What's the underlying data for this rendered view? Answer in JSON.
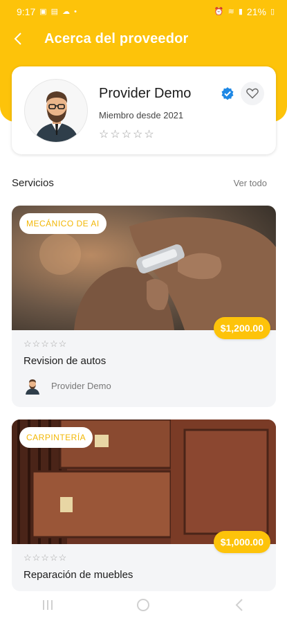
{
  "status_bar": {
    "time": "9:17",
    "battery": "21%"
  },
  "app_bar": {
    "title": "Acerca del proveedor",
    "back_icon": "back-arrow-icon"
  },
  "provider": {
    "name": "Provider Demo",
    "member_since": "Miembro desde 2021",
    "rating_stars": "☆☆☆☆☆",
    "verified_icon": "verified-badge-icon",
    "favorite_icon": "heart-outline-icon"
  },
  "services_section": {
    "title": "Servicios",
    "see_all": "Ver todo"
  },
  "services": [
    {
      "category": "MECÁNICO DE AI",
      "price": "$1,200.00",
      "stars": "☆☆☆☆☆",
      "title": "Revision de autos",
      "provider_name": "Provider Demo"
    },
    {
      "category": "CARPINTERÍA",
      "price": "$1,000.00",
      "stars": "☆☆☆☆☆",
      "title": "Reparación de muebles"
    }
  ],
  "nav_bar": {
    "recents_icon": "recents-icon",
    "home_icon": "home-icon",
    "back_icon": "back-icon"
  },
  "colors": {
    "primary": "#FDC30A",
    "verified": "#1E88E5"
  }
}
